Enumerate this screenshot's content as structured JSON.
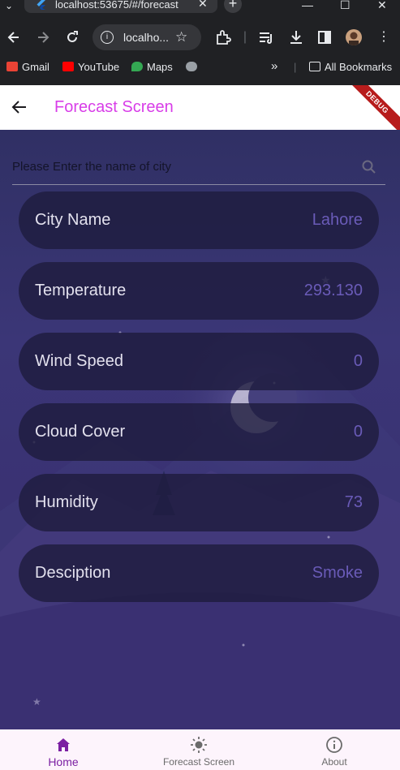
{
  "browser": {
    "tab_title": "localhost:53675/#/forecast",
    "omnibox_text": "localho...",
    "bookmarks": [
      {
        "label": "Gmail",
        "icon": "gmail-icon",
        "color": "#ea4335"
      },
      {
        "label": "YouTube",
        "icon": "youtube-icon",
        "color": "#ff0000"
      },
      {
        "label": "Maps",
        "icon": "maps-icon",
        "color": "#34a853"
      },
      {
        "label": "",
        "icon": "globe-icon",
        "color": "#9aa0a6"
      }
    ],
    "overflow_label": "»",
    "all_bookmarks_label": "All Bookmarks"
  },
  "app": {
    "title": "Forecast Screen",
    "debug_label": "DEBUG",
    "accent": "#d83de8"
  },
  "search": {
    "placeholder": "Please Enter the name of city"
  },
  "cards": [
    {
      "label": "City Name",
      "value": "Lahore"
    },
    {
      "label": "Temperature",
      "value": "293.130"
    },
    {
      "label": "Wind Speed",
      "value": "0"
    },
    {
      "label": "Cloud Cover",
      "value": "0"
    },
    {
      "label": "Humidity",
      "value": "73"
    },
    {
      "label": "Desciption",
      "value": "Smoke"
    }
  ],
  "nav": {
    "items": [
      {
        "label": "Home",
        "icon": "home-icon",
        "active": true
      },
      {
        "label": "Forecast Screen",
        "icon": "sun-icon",
        "active": false
      },
      {
        "label": "About",
        "icon": "info-icon",
        "active": false
      }
    ],
    "active_color": "#7b1fa2"
  }
}
